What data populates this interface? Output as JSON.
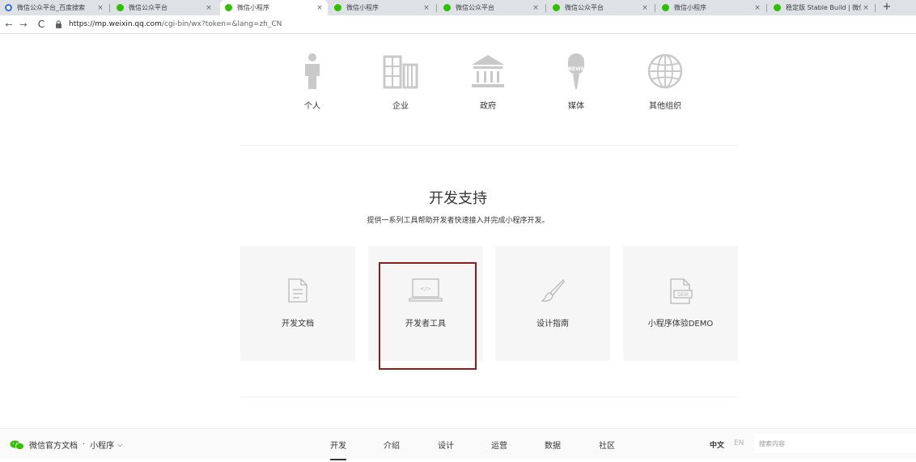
{
  "browser": {
    "tabs": [
      {
        "title": "微信公众平台_百度搜索",
        "favicon": "baidu-icon",
        "active": false
      },
      {
        "title": "微信公众平台",
        "favicon": "wechat-icon",
        "active": false
      },
      {
        "title": "微信小程序",
        "favicon": "wechat-icon",
        "active": true
      },
      {
        "title": "微信小程序",
        "favicon": "wechat-icon",
        "active": false
      },
      {
        "title": "微信公众平台",
        "favicon": "wechat-icon",
        "active": false
      },
      {
        "title": "微信公众平台",
        "favicon": "wechat-icon",
        "active": false
      },
      {
        "title": "微信小程序",
        "favicon": "wechat-icon",
        "active": false
      },
      {
        "title": "稳定版 Stable Build | 微信",
        "favicon": "wechat-icon",
        "active": false
      }
    ],
    "close_glyph": "×",
    "new_tab_glyph": "+",
    "back_glyph": "←",
    "forward_glyph": "→",
    "reload_glyph": "C",
    "url_host": "https://mp.weixin.qq.com",
    "url_path": "/cgi-bin/wx?token=&lang=zh_CN"
  },
  "categories": [
    {
      "label": "个人",
      "icon": "person-icon"
    },
    {
      "label": "企业",
      "icon": "building-icon"
    },
    {
      "label": "政府",
      "icon": "government-icon"
    },
    {
      "label": "媒体",
      "icon": "microphone-news-icon",
      "icon_text": "NEWS"
    },
    {
      "label": "其他组织",
      "icon": "globe-icon"
    }
  ],
  "dev_support": {
    "title": "开发支持",
    "description": "提供一系列工具帮助开发者快速接入并完成小程序开发。",
    "cards": [
      {
        "label": "开发文档",
        "icon": "document-icon"
      },
      {
        "label": "开发者工具",
        "icon": "laptop-code-icon",
        "icon_text": "</>"
      },
      {
        "label": "设计指南",
        "icon": "brush-icon"
      },
      {
        "label": "小程序体验DEMO",
        "icon": "demo-file-icon",
        "icon_text": "DEM"
      }
    ]
  },
  "bottom_bar": {
    "brand": "微信官方文档",
    "separator": "·",
    "product": "小程序",
    "caret": "⌵",
    "nav": [
      {
        "label": "开发",
        "active": true
      },
      {
        "label": "介绍",
        "active": false
      },
      {
        "label": "设计",
        "active": false
      },
      {
        "label": "运营",
        "active": false
      },
      {
        "label": "数据",
        "active": false
      },
      {
        "label": "社区",
        "active": false
      }
    ],
    "lang_zh": "中文",
    "lang_en": "EN",
    "search_placeholder": "搜索内容"
  },
  "colors": {
    "highlight_border": "#8b1e1e",
    "wechat_green": "#2dc100",
    "icon_gray": "#c9c9c9"
  }
}
